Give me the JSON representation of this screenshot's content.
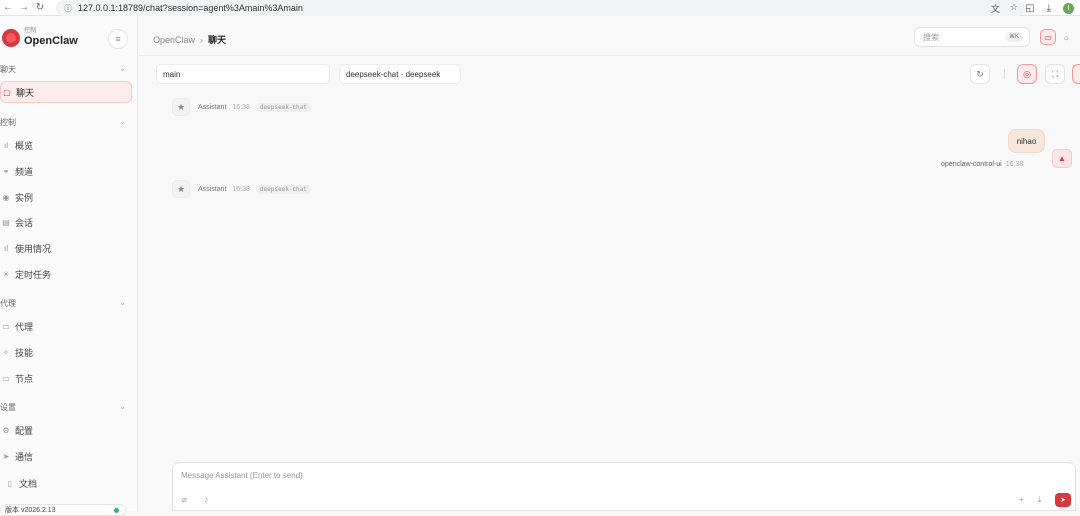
{
  "browser": {
    "url": "127.0.0.1:18789/chat?session=agent%3Amain%3Amain",
    "profile_initial": "I"
  },
  "sidebar": {
    "brand_small": "控制",
    "brand_name": "OpenClaw",
    "sections": {
      "chat": "聊天",
      "control": "控制",
      "agent": "代理",
      "settings": "设置"
    },
    "items": {
      "chat": "聊天",
      "overview": "概览",
      "channels": "频道",
      "instances": "实例",
      "sessions": "会话",
      "usage": "使用情况",
      "cron": "定时任务",
      "agents": "代理",
      "skills": "技能",
      "nodes": "节点",
      "config": "配置",
      "debug": "通信",
      "docs": "文档"
    },
    "version": "版本 v2026.2.13"
  },
  "header": {
    "crumb_root": "OpenClaw",
    "crumb_sep": "›",
    "crumb_current": "聊天",
    "search_placeholder": "搜索",
    "search_shortcut": "⌘K"
  },
  "toolbar": {
    "session": "main",
    "model": "deepseek-chat · deepseek"
  },
  "messages": [
    {
      "role": "Assistant",
      "time": "16:38",
      "model": "deepseek-chat"
    },
    {
      "role": "user",
      "text": "nihao",
      "sender": "openclaw-control-ui",
      "time": "16:38"
    },
    {
      "role": "Assistant",
      "time": "16:38",
      "model": "deepseek-chat"
    }
  ],
  "composer": {
    "placeholder": "Message Assistant (Enter to send)"
  },
  "colors": {
    "accent": "#d9363e",
    "bubble": "#f6e6dc"
  }
}
